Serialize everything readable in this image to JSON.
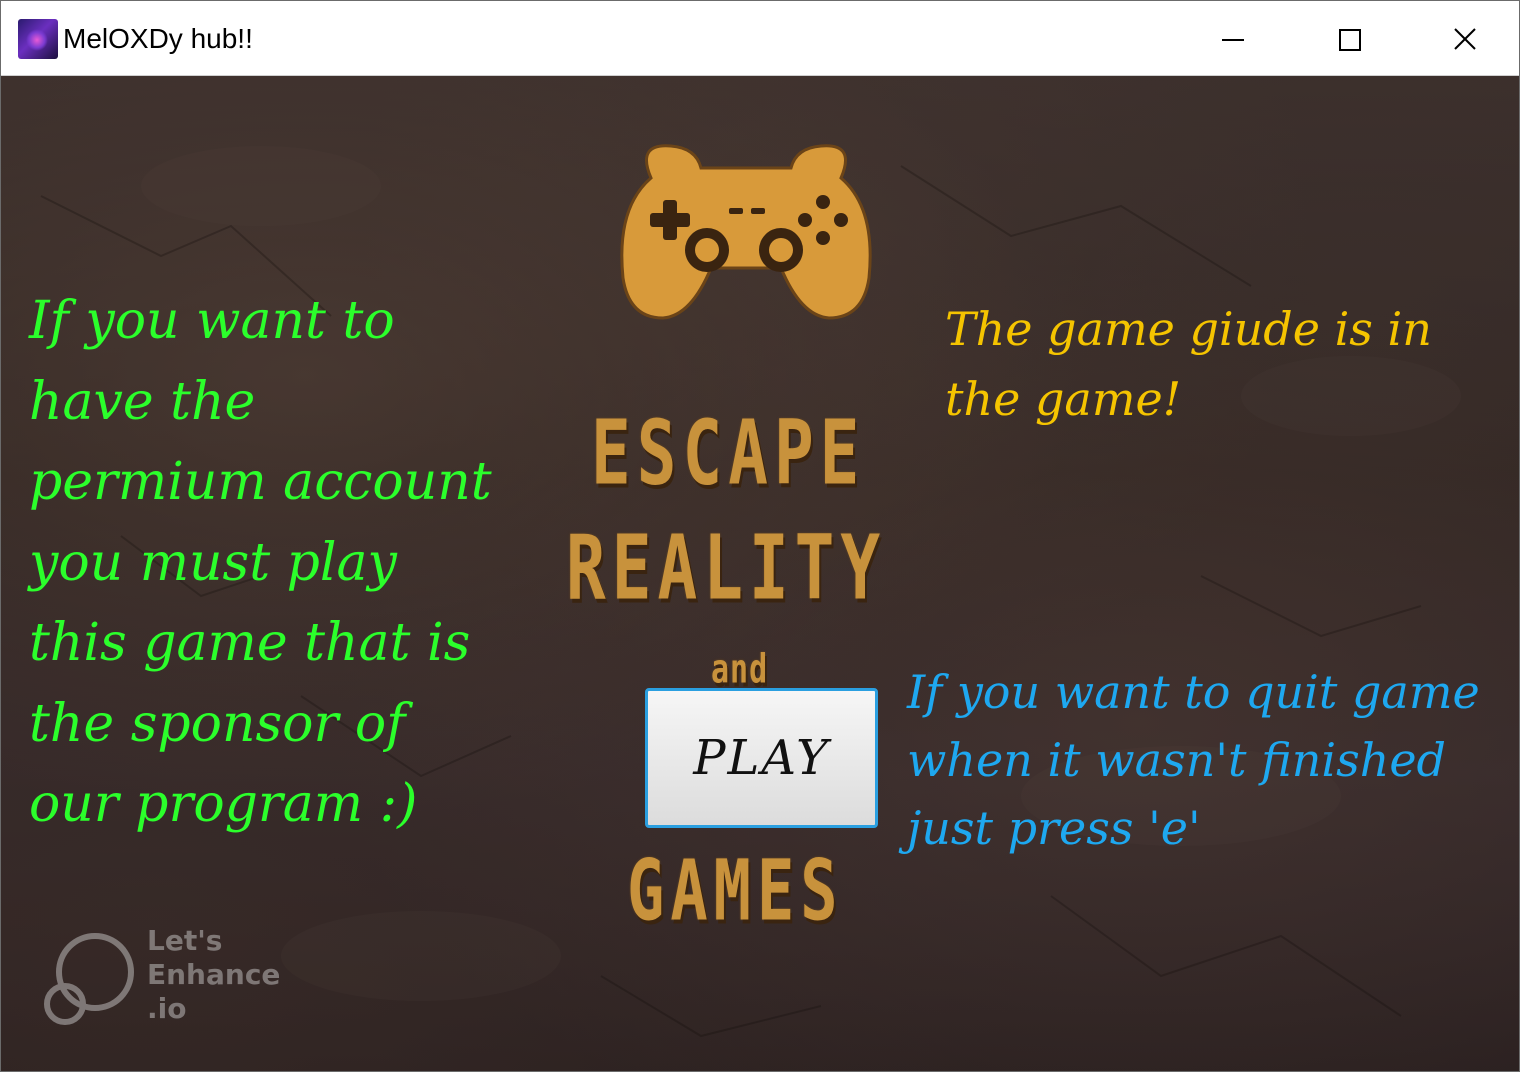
{
  "window": {
    "title": "MelOXDy hub!!"
  },
  "poster": {
    "line1": "ESCAPE",
    "line2": "REALITY",
    "line3": "and",
    "line4": "GAMES"
  },
  "messages": {
    "premium": "If you want to have the permium account you must play this game that is the sponsor of our program :)",
    "guide": "The game giude is in the game!",
    "quit": "If you want to quit game when it wasn't finished just press 'e'"
  },
  "play_button": {
    "label": "PLAY"
  },
  "watermark": {
    "line1": "Let's",
    "line2": "Enhance",
    "line3": ".io"
  },
  "colors": {
    "premium_text": "#2bff2b",
    "guide_text": "#f5c400",
    "quit_text": "#1ea8f0",
    "poster_text": "#c8923c",
    "button_border": "#2a9fe0"
  },
  "icons": {
    "app": "app-icon",
    "controller": "gamepad-icon"
  }
}
